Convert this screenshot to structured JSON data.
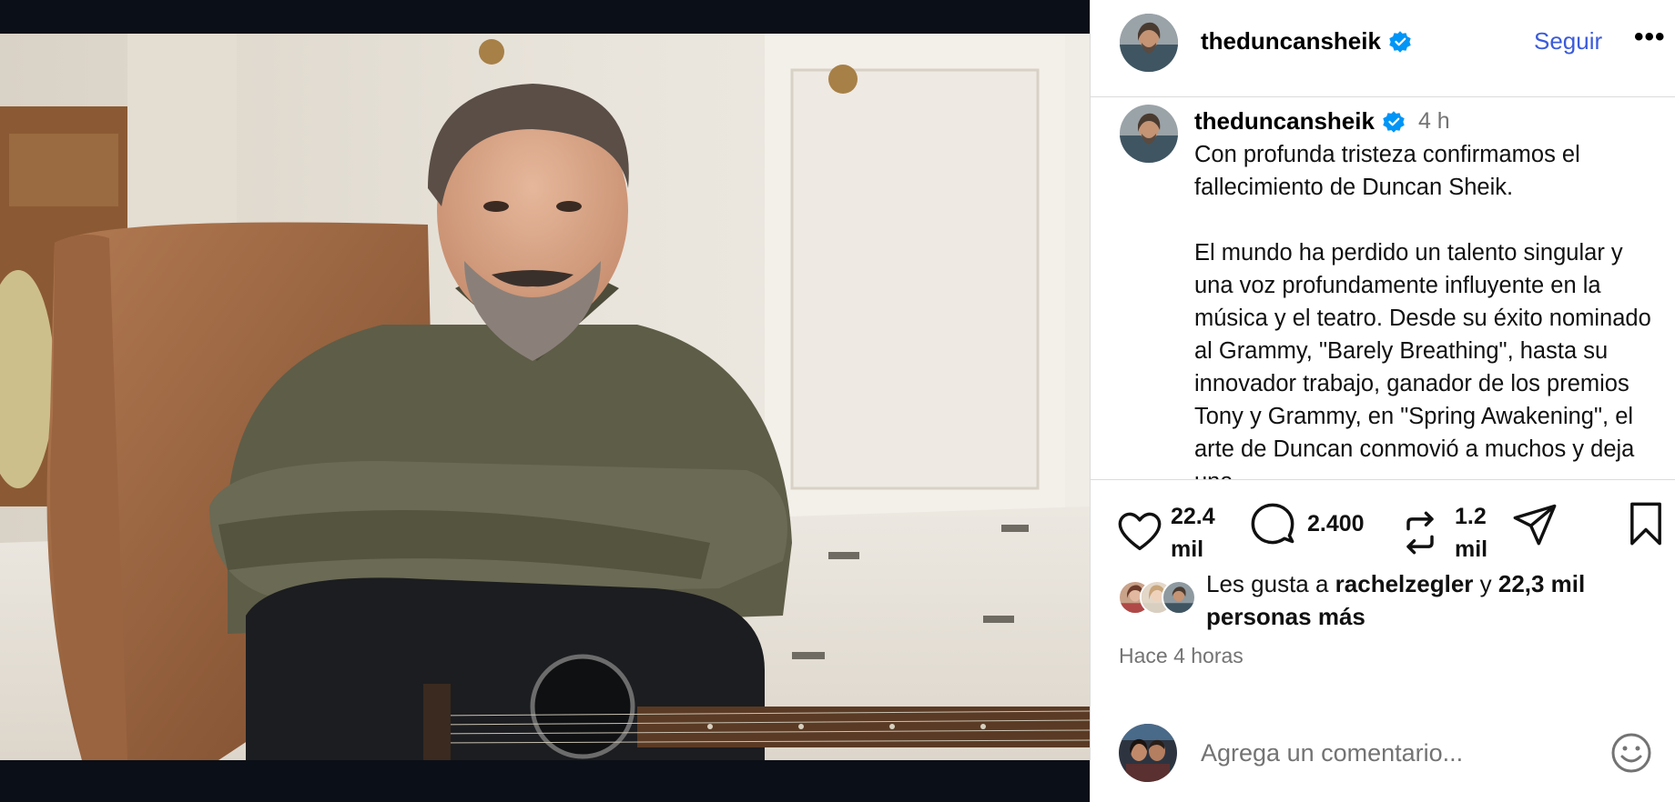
{
  "post": {
    "username": "theduncansheik",
    "follow_label": "Seguir",
    "more_label": "•••",
    "time_ago": "4 h",
    "caption": "Con profunda tristeza confirmamos el fallecimiento de Duncan Sheik.\n\nEl mundo ha perdido un talento singular y una voz profundamente influyente en la música y el teatro. Desde su éxito nominado al Grammy, \"Barely Breathing\", hasta su innovador trabajo, ganador de los premios Tony y Grammy, en \"Spring Awakening\", el arte de Duncan conmovió a muchos y deja una",
    "verified_icon": "verified-badge-icon",
    "accent_color": "#0095f6"
  },
  "actions": {
    "like_count": "22.4\nmil",
    "comment_count": "2.400",
    "repost_count": "1.2\nmil",
    "icons": [
      "heart-icon",
      "comment-icon",
      "repost-icon",
      "share-icon",
      "bookmark-icon"
    ]
  },
  "likes": {
    "prefix": "Les gusta a ",
    "liker": "rachelzegler",
    "middle": " y ",
    "others": "22,3 mil personas más"
  },
  "timestamp": "Hace 4 horas",
  "comment": {
    "placeholder": "Agrega un comentario...",
    "emoji_icon": "smiley-icon"
  }
}
